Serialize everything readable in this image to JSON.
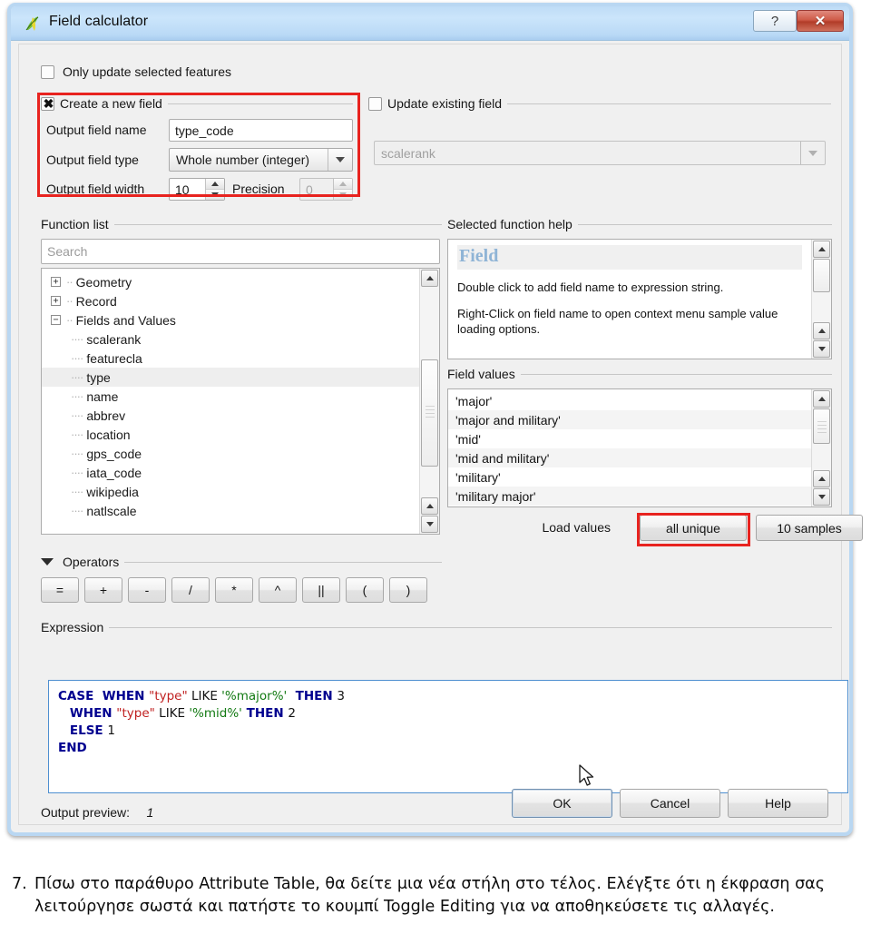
{
  "window": {
    "title": "Field calculator",
    "icon": "qgis-leaf-icon",
    "help_button": "?",
    "close_button": "✕"
  },
  "options": {
    "only_update_selected": {
      "label": "Only update selected features",
      "checked": false
    },
    "create_new_field": {
      "label": "Create a new field",
      "checked": true
    },
    "update_existing_field": {
      "label": "Update existing field",
      "checked": false
    },
    "existing_field_value": "scalerank"
  },
  "new_field": {
    "name_label": "Output field name",
    "name_value": "type_code",
    "type_label": "Output field type",
    "type_value": "Whole number (integer)",
    "width_label": "Output field width",
    "width_value": "10",
    "precision_label": "Precision",
    "precision_value": "0"
  },
  "function_list": {
    "group_title": "Function list",
    "search_placeholder": "Search",
    "search_value": "",
    "tree": [
      {
        "label": "Geometry",
        "type": "group",
        "expanded": false,
        "indent": 0
      },
      {
        "label": "Record",
        "type": "group",
        "expanded": false,
        "indent": 0
      },
      {
        "label": "Fields and Values",
        "type": "group",
        "expanded": true,
        "indent": 0
      },
      {
        "label": "scalerank",
        "type": "leaf",
        "indent": 1,
        "selected": false
      },
      {
        "label": "featurecla",
        "type": "leaf",
        "indent": 1,
        "selected": false
      },
      {
        "label": "type",
        "type": "leaf",
        "indent": 1,
        "selected": true
      },
      {
        "label": "name",
        "type": "leaf",
        "indent": 1,
        "selected": false
      },
      {
        "label": "abbrev",
        "type": "leaf",
        "indent": 1,
        "selected": false
      },
      {
        "label": "location",
        "type": "leaf",
        "indent": 1,
        "selected": false
      },
      {
        "label": "gps_code",
        "type": "leaf",
        "indent": 1,
        "selected": false
      },
      {
        "label": "iata_code",
        "type": "leaf",
        "indent": 1,
        "selected": false
      },
      {
        "label": "wikipedia",
        "type": "leaf",
        "indent": 1,
        "selected": false
      },
      {
        "label": "natlscale",
        "type": "leaf",
        "indent": 1,
        "selected": false
      }
    ]
  },
  "function_help": {
    "group_title": "Selected function help",
    "heading": "Field",
    "paragraph_1": "Double click to add field name to expression string.",
    "paragraph_2": "Right-Click on field name to open context menu sample value loading options."
  },
  "field_values": {
    "group_title": "Field values",
    "values": [
      "'major'",
      "'major and military'",
      "'mid'",
      "'mid and military'",
      "'military'",
      "'military major'"
    ],
    "load_values_label": "Load values",
    "all_unique_button": "all unique",
    "samples_button": "10 samples"
  },
  "operators": {
    "group_title": "Operators",
    "expanded": true,
    "buttons": [
      "=",
      "+",
      "-",
      "/",
      "*",
      "^",
      "||",
      "(",
      ")"
    ]
  },
  "expression": {
    "group_title": "Expression",
    "lines": [
      [
        {
          "t": "CASE  ",
          "c": "kw"
        },
        {
          "t": "WHEN ",
          "c": "kw"
        },
        {
          "t": "\"type\"",
          "c": "fld"
        },
        {
          "t": " LIKE ",
          "c": "pln"
        },
        {
          "t": "'%major%'",
          "c": "str"
        },
        {
          "t": "  THEN ",
          "c": "kw"
        },
        {
          "t": "3",
          "c": "pln"
        }
      ],
      [
        {
          "t": "   ",
          "c": "pln"
        },
        {
          "t": "WHEN ",
          "c": "kw"
        },
        {
          "t": "\"type\"",
          "c": "fld"
        },
        {
          "t": " LIKE ",
          "c": "pln"
        },
        {
          "t": "'%mid%'",
          "c": "str"
        },
        {
          "t": " THEN ",
          "c": "kw"
        },
        {
          "t": "2",
          "c": "pln"
        }
      ],
      [
        {
          "t": "   ",
          "c": "pln"
        },
        {
          "t": "ELSE ",
          "c": "kw"
        },
        {
          "t": "1",
          "c": "pln"
        }
      ],
      [
        {
          "t": "END",
          "c": "kw"
        }
      ]
    ],
    "plain_text": "CASE  WHEN \"type\" LIKE '%major%'  THEN 3\n   WHEN \"type\" LIKE '%mid%' THEN 2\n   ELSE 1\nEND"
  },
  "footer": {
    "output_preview_label": "Output preview:",
    "output_preview_value": "1",
    "ok_button": "OK",
    "cancel_button": "Cancel",
    "help_button": "Help"
  },
  "caption": {
    "number": "7.",
    "text": "Πίσω στο παράθυρο Attribute Table, θα δείτε μια νέα στήλη στο τέλος. Ελέγξτε ότι η έκφραση σας λειτούργησε σωστά και πατήστε το κουμπί Toggle Editing για να αποθηκεύσετε τις αλλαγές."
  },
  "highlights": {
    "accent_red": "#e8231f",
    "focus_blue": "#4e8fd0",
    "titlebar_blue": "#bedcf6"
  }
}
